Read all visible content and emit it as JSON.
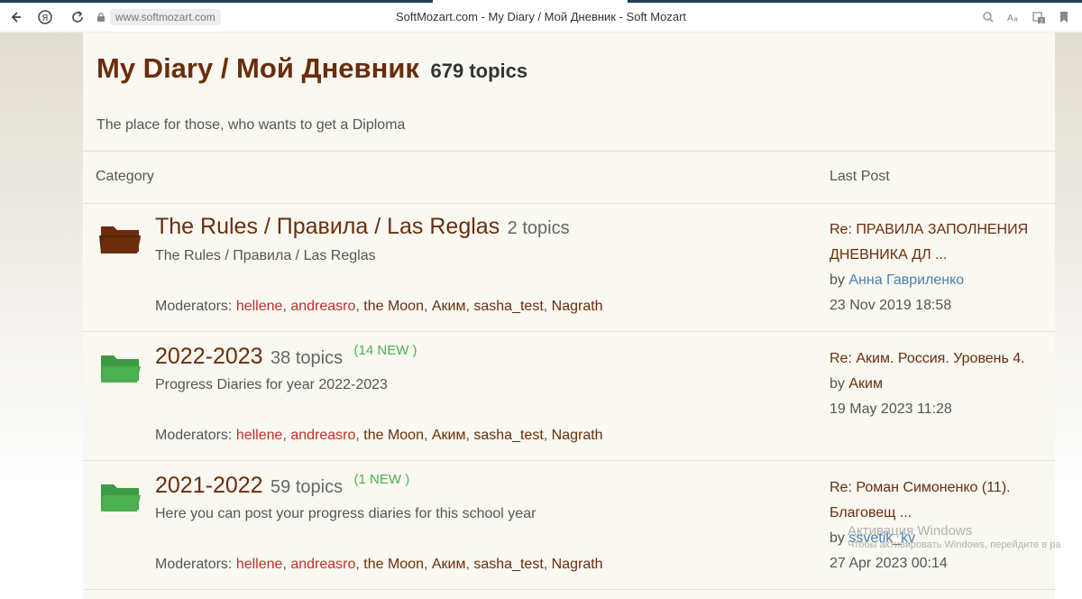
{
  "browser": {
    "url": "www.softmozart.com",
    "title": "SoftMozart.com - My Diary / Мой Дневник - Soft Mozart"
  },
  "forum": {
    "title": "My Diary / Мой Дневник",
    "count": "679 topics",
    "description": "The place for those, who wants to get a Diploma",
    "col_category": "Category",
    "col_last_post": "Last Post"
  },
  "moderators_label": "Moderators:",
  "categories": [
    {
      "title": "The Rules / Правила / Las Reglas",
      "topics": "2 topics",
      "new": "",
      "description": "The Rules / Правила / Las Reglas",
      "folder_color": "#6b2d0c",
      "moderators": [
        "hellene",
        "andreasro",
        "the Moon",
        "Аким",
        "sasha_test",
        "Nagrath"
      ],
      "last_post": {
        "title_line1": "Re: ПРАВИЛА ЗАПОЛНЕНИЯ",
        "title_line2": "ДНЕВНИКА ДЛ ...",
        "by": "by",
        "author": "Анна Гавриленко",
        "date": "23 Nov 2019 18:58"
      }
    },
    {
      "title": "2022-2023",
      "topics": "38 topics",
      "new": "(14 NEW )",
      "description": "Progress Diaries for year 2022-2023",
      "folder_color": "#4caf50",
      "moderators": [
        "hellene",
        "andreasro",
        "the Moon",
        "Аким",
        "sasha_test",
        "Nagrath"
      ],
      "last_post": {
        "title_line1": "Re: Аким. Россия. Уровень 4.",
        "title_line2": "",
        "by": "by",
        "author": "Аким",
        "date": "19 May 2023 11:28"
      }
    },
    {
      "title": "2021-2022",
      "topics": "59 topics",
      "new": "(1 NEW )",
      "description": "Here you can post your progress diaries for this school year",
      "folder_color": "#4caf50",
      "moderators": [
        "hellene",
        "andreasro",
        "the Moon",
        "Аким",
        "sasha_test",
        "Nagrath"
      ],
      "last_post": {
        "title_line1": "Re: Роман Симоненко (11).",
        "title_line2": "Благовещ ...",
        "by": "by",
        "author": "ssvetik_kv",
        "date": "27 Apr 2023 00:14"
      }
    }
  ],
  "windows_overlay": {
    "line1": "Активация Windows",
    "line2": "Чтобы активировать Windows, перейдите в ра"
  }
}
